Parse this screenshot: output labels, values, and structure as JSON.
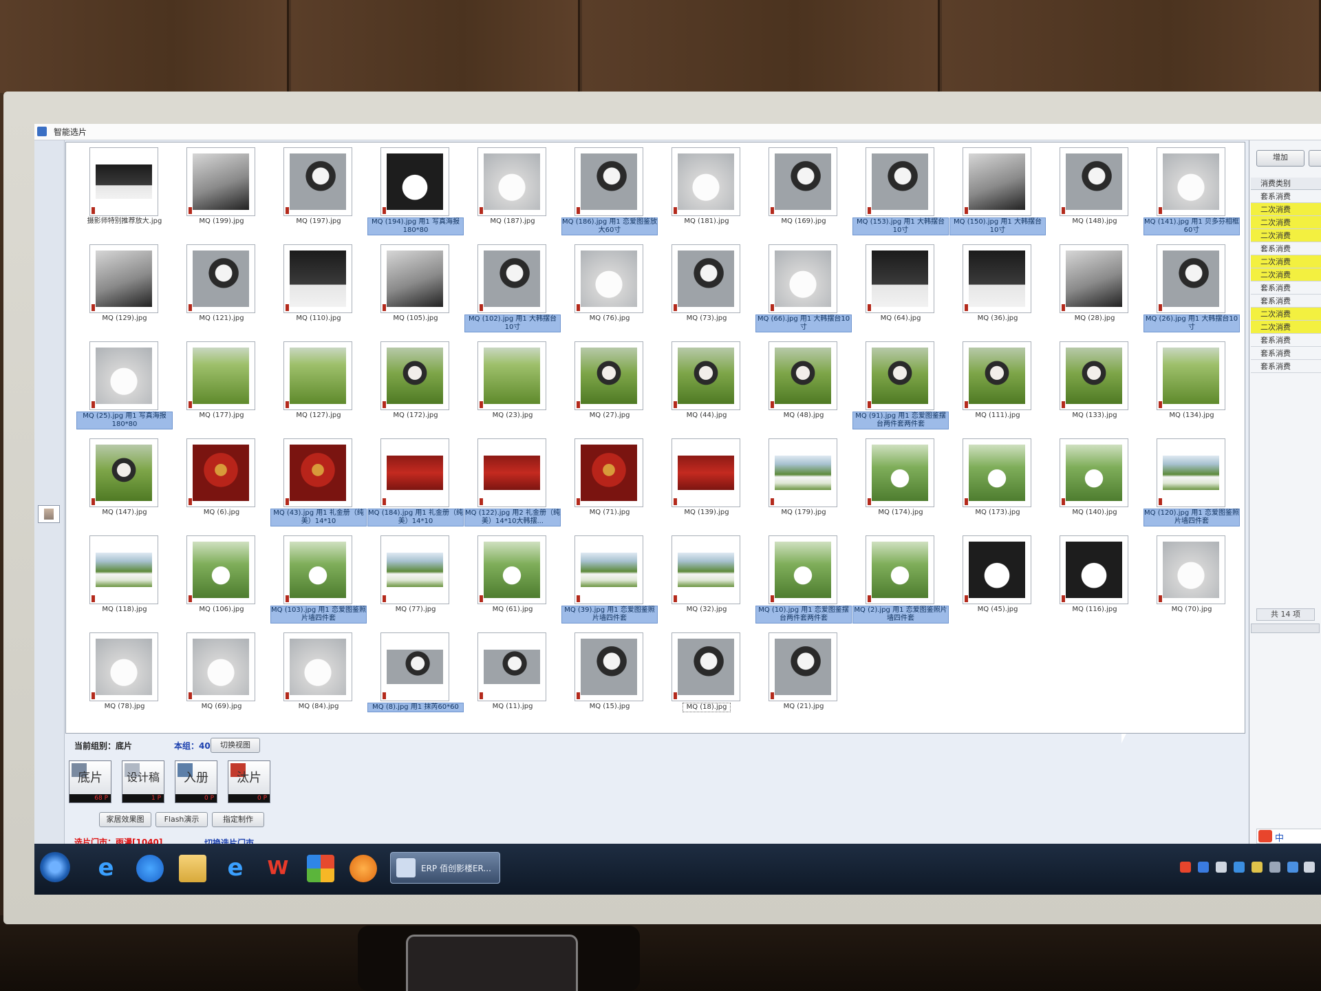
{
  "window": {
    "title": "智能选片"
  },
  "thumbnails": [
    [
      {
        "label": "摄影师特别推荐放大.jpg",
        "selected": false,
        "theme": "dark",
        "wide": true
      },
      {
        "label": "MQ (199).jpg",
        "selected": false,
        "theme": "bw"
      },
      {
        "label": "MQ (197).jpg",
        "selected": false,
        "theme": "studio"
      },
      {
        "label": "MQ (194).jpg 用1 写真海报180*80",
        "selected": true,
        "theme": "gown"
      },
      {
        "label": "MQ (187).jpg",
        "selected": false,
        "theme": "gown2"
      },
      {
        "label": "MQ (186).jpg 用1 恋爱图鉴放大60寸",
        "selected": true,
        "theme": "studio"
      },
      {
        "label": "MQ (181).jpg",
        "selected": false,
        "theme": "gown2"
      },
      {
        "label": "MQ (169).jpg",
        "selected": false,
        "theme": "studio"
      },
      {
        "label": "MQ (153).jpg 用1 大韩摆台10寸",
        "selected": true,
        "theme": "studio"
      },
      {
        "label": "MQ (150).jpg 用1 大韩摆台10寸",
        "selected": true,
        "theme": "bw"
      },
      {
        "label": "MQ (148).jpg",
        "selected": false,
        "theme": "studio"
      },
      {
        "label": "MQ (141).jpg 用1 贝多芬相框60寸",
        "selected": true,
        "theme": "gown2"
      }
    ],
    [
      {
        "label": "MQ (129).jpg",
        "selected": false,
        "theme": "bw"
      },
      {
        "label": "MQ (121).jpg",
        "selected": false,
        "theme": "studio"
      },
      {
        "label": "MQ (110).jpg",
        "selected": false,
        "theme": "dark"
      },
      {
        "label": "MQ (105).jpg",
        "selected": false,
        "theme": "bw"
      },
      {
        "label": "MQ (102).jpg 用1 大韩摆台10寸",
        "selected": true,
        "theme": "studio"
      },
      {
        "label": "MQ (76).jpg",
        "selected": false,
        "theme": "gown2"
      },
      {
        "label": "MQ (73).jpg",
        "selected": false,
        "theme": "studio"
      },
      {
        "label": "MQ (66).jpg 用1 大韩摆台10寸",
        "selected": true,
        "theme": "gown2"
      },
      {
        "label": "MQ (64).jpg",
        "selected": false,
        "theme": "dark"
      },
      {
        "label": "MQ (36).jpg",
        "selected": false,
        "theme": "dark"
      },
      {
        "label": "MQ (28).jpg",
        "selected": false,
        "theme": "bw"
      },
      {
        "label": "MQ (26).jpg 用1 大韩摆台10寸",
        "selected": true,
        "theme": "studio"
      }
    ],
    [
      {
        "label": "MQ (25).jpg 用1 写真海报180*80",
        "selected": true,
        "theme": "gown2"
      },
      {
        "label": "MQ (177).jpg",
        "selected": false,
        "theme": "field"
      },
      {
        "label": "MQ (127).jpg",
        "selected": false,
        "theme": "field"
      },
      {
        "label": "MQ (172).jpg",
        "selected": false,
        "theme": "field2"
      },
      {
        "label": "MQ (23).jpg",
        "selected": false,
        "theme": "field"
      },
      {
        "label": "MQ (27).jpg",
        "selected": false,
        "theme": "field2"
      },
      {
        "label": "MQ (44).jpg",
        "selected": false,
        "theme": "field2"
      },
      {
        "label": "MQ (48).jpg",
        "selected": false,
        "theme": "field2"
      },
      {
        "label": "MQ (91).jpg 用1 恋爱图鉴摆台两件套两件套",
        "selected": true,
        "theme": "field2"
      },
      {
        "label": "MQ (111).jpg",
        "selected": false,
        "theme": "field2"
      },
      {
        "label": "MQ (133).jpg",
        "selected": false,
        "theme": "field2"
      },
      {
        "label": "MQ (134).jpg",
        "selected": false,
        "theme": "field"
      }
    ],
    [
      {
        "label": "MQ (147).jpg",
        "selected": false,
        "theme": "field2"
      },
      {
        "label": "MQ (6).jpg",
        "selected": false,
        "theme": "red"
      },
      {
        "label": "MQ (43).jpg 用1 礼金册（纯美）14*10",
        "selected": true,
        "theme": "red"
      },
      {
        "label": "MQ (184).jpg 用1 礼金册（纯美）14*10",
        "selected": true,
        "theme": "red2",
        "wide": true
      },
      {
        "label": "MQ (122).jpg 用2 礼金册（纯美）14*10大韩摆...",
        "selected": true,
        "theme": "red2",
        "wide": true
      },
      {
        "label": "MQ (71).jpg",
        "selected": false,
        "theme": "red"
      },
      {
        "label": "MQ (139).jpg",
        "selected": false,
        "theme": "red2",
        "wide": true
      },
      {
        "label": "MQ (179).jpg",
        "selected": false,
        "theme": "garden",
        "wide": true
      },
      {
        "label": "MQ (174).jpg",
        "selected": false,
        "theme": "garden2"
      },
      {
        "label": "MQ (173).jpg",
        "selected": false,
        "theme": "garden2"
      },
      {
        "label": "MQ (140).jpg",
        "selected": false,
        "theme": "garden2"
      },
      {
        "label": "MQ (120).jpg 用1 恋爱图鉴照片墙四件套",
        "selected": true,
        "theme": "garden",
        "wide": true
      }
    ],
    [
      {
        "label": "MQ (118).jpg",
        "selected": false,
        "theme": "garden",
        "wide": true
      },
      {
        "label": "MQ (106).jpg",
        "selected": false,
        "theme": "garden2"
      },
      {
        "label": "MQ (103).jpg 用1 恋爱图鉴照片墙四件套",
        "selected": true,
        "theme": "garden2"
      },
      {
        "label": "MQ (77).jpg",
        "selected": false,
        "theme": "garden",
        "wide": true
      },
      {
        "label": "MQ (61).jpg",
        "selected": false,
        "theme": "garden2"
      },
      {
        "label": "MQ (39).jpg 用1 恋爱图鉴照片墙四件套",
        "selected": true,
        "theme": "garden",
        "wide": true
      },
      {
        "label": "MQ (32).jpg",
        "selected": false,
        "theme": "garden",
        "wide": true
      },
      {
        "label": "MQ (10).jpg 用1 恋爱图鉴摆台两件套两件套",
        "selected": true,
        "theme": "garden2"
      },
      {
        "label": "MQ (2).jpg 用1 恋爱图鉴照片墙四件套",
        "selected": true,
        "theme": "garden2"
      },
      {
        "label": "MQ (45).jpg",
        "selected": false,
        "theme": "gown"
      },
      {
        "label": "MQ (116).jpg",
        "selected": false,
        "theme": "gown"
      },
      {
        "label": "MQ (70).jpg",
        "selected": false,
        "theme": "gown2"
      }
    ],
    [
      {
        "label": "MQ (78).jpg",
        "selected": false,
        "theme": "gown2"
      },
      {
        "label": "MQ (69).jpg",
        "selected": false,
        "theme": "gown2"
      },
      {
        "label": "MQ (84).jpg",
        "selected": false,
        "theme": "gown2"
      },
      {
        "label": "MQ (8).jpg 用1 抹芮60*60",
        "selected": true,
        "theme": "studio",
        "wide": true
      },
      {
        "label": "MQ (11).jpg",
        "selected": false,
        "theme": "studio",
        "wide": true
      },
      {
        "label": "MQ (15).jpg",
        "selected": false,
        "theme": "studio"
      },
      {
        "label": "MQ (18).jpg",
        "selected": false,
        "theme": "studio",
        "focused": true
      },
      {
        "label": "MQ (21).jpg",
        "selected": false,
        "theme": "studio"
      }
    ]
  ],
  "controls": {
    "current_group": "当前组别：底片",
    "group_count": "本组：40",
    "switch_view": "切换视图",
    "big_buttons": [
      {
        "label": "底片",
        "count": "68 P"
      },
      {
        "label": "设计稿",
        "count": "1 P"
      },
      {
        "label": "入册",
        "count": "0 P"
      },
      {
        "label": "汰片",
        "count": "0 P"
      }
    ],
    "home_effect": "家居效果图",
    "flash_demo": "Flash演示",
    "assign_make": "指定制作",
    "store_label": "选片门市：",
    "store_name": "雨漫[1040]",
    "switch_store": "切换选片门市"
  },
  "right_panel": {
    "add_button": "增加",
    "header": "消费类别",
    "rows": [
      {
        "text": "套系消费",
        "highlight": false
      },
      {
        "text": "二次消费",
        "highlight": true
      },
      {
        "text": "二次消费",
        "highlight": true
      },
      {
        "text": "二次消费",
        "highlight": true
      },
      {
        "text": "套系消费",
        "highlight": false
      },
      {
        "text": "二次消费",
        "highlight": true
      },
      {
        "text": "二次消费",
        "highlight": true
      },
      {
        "text": "套系消费",
        "highlight": false
      },
      {
        "text": "套系消费",
        "highlight": false
      },
      {
        "text": "二次消费",
        "highlight": true
      },
      {
        "text": "二次消费",
        "highlight": true
      },
      {
        "text": "套系消费",
        "highlight": false
      },
      {
        "text": "套系消费",
        "highlight": false
      },
      {
        "text": "套系消费",
        "highlight": false
      }
    ],
    "count": "共 14 项",
    "ime_text": "中"
  },
  "taskbar": {
    "active_task": "ERP 佰创影楼ER..."
  }
}
